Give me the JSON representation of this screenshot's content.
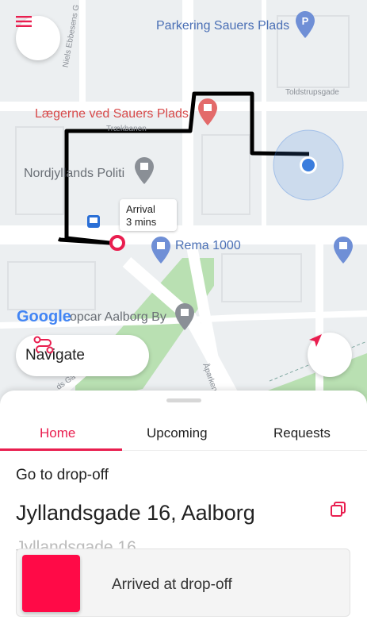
{
  "map": {
    "labels": {
      "parkering": "Parkering Sauers Plads",
      "laegerne": "Lægerne ved Sauers Plads",
      "politi": "Nordjyllands Politi",
      "rema": "Rema 1000",
      "opcar": "opcar Aalborg By",
      "google": "Google",
      "toldstrups": "Toldstrupsgade",
      "trekbanen": "Trækbanen",
      "niels": "Niels Ebbesens G",
      "aparken": "Åparken",
      "gade": "ds Ga"
    },
    "arrival": {
      "line1": "Arrival",
      "line2": "3 mins"
    },
    "navigate_label": "Navigate"
  },
  "tabs": [
    "Home",
    "Upcoming",
    "Requests"
  ],
  "active_tab": "Home",
  "step": "Go to drop-off",
  "address": "Jyllandsgade 16, Aalborg",
  "address_sub": "Jyllandsgade 16",
  "slider_label": "Arrived at drop-off",
  "colors": {
    "accent": "#e91e4f",
    "thumb": "#ff0a47",
    "park": "#b9e0b2",
    "route": "#000000",
    "location": "#3b7ddd"
  }
}
